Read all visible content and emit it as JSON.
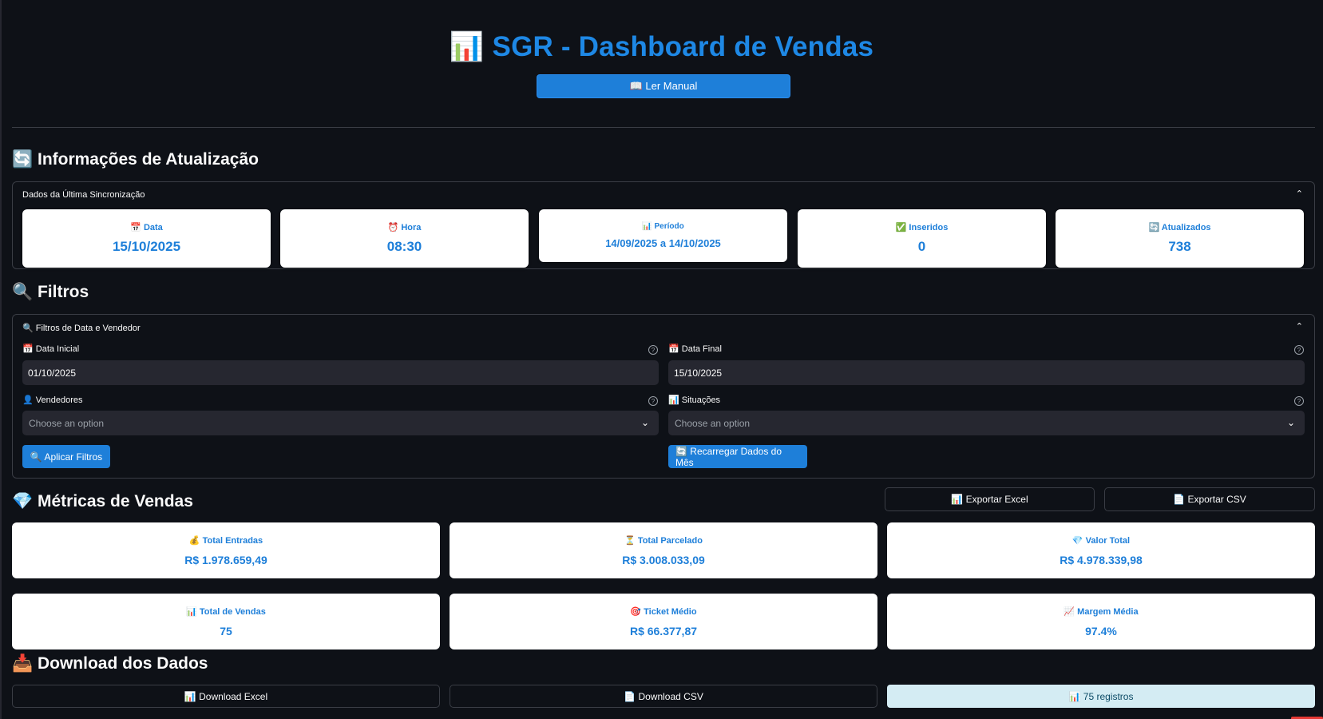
{
  "header": {
    "title": "📊 SGR - Dashboard de Vendas",
    "manual_button": "📖 Ler Manual"
  },
  "update_info": {
    "section_title": "🔄 Informações de Atualização",
    "expander_label": "Dados da Última Sincronização",
    "cards": [
      {
        "label": "📅 Data",
        "value": "15/10/2025"
      },
      {
        "label": "⏰ Hora",
        "value": "08:30"
      },
      {
        "label": "📊 Período",
        "value": "14/09/2025 a 14/10/2025"
      },
      {
        "label": "✅ Inseridos",
        "value": "0"
      },
      {
        "label": "🔄 Atualizados",
        "value": "738"
      }
    ]
  },
  "filters": {
    "section_title": "🔍 Filtros",
    "expander_label": "🔍 Filtros de Data e Vendedor",
    "start_date_label": "📅 Data Inicial",
    "start_date_value": "01/10/2025",
    "end_date_label": "📅 Data Final",
    "end_date_value": "15/10/2025",
    "sellers_label": "👤 Vendedores",
    "sellers_placeholder": "Choose an option",
    "status_label": "📊 Situações",
    "status_placeholder": "Choose an option",
    "apply_button": "🔍 Aplicar Filtros",
    "reload_button": "🔄 Recarregar Dados do Mês"
  },
  "metrics": {
    "section_title": "💎 Métricas de Vendas",
    "export_excel": "📊 Exportar Excel",
    "export_csv": "📄 Exportar CSV",
    "cards": [
      {
        "label": "💰 Total Entradas",
        "value": "R$ 1.978.659,49"
      },
      {
        "label": "⏳ Total Parcelado",
        "value": "R$ 3.008.033,09"
      },
      {
        "label": "💎 Valor Total",
        "value": "R$ 4.978.339,98"
      },
      {
        "label": "📊 Total de Vendas",
        "value": "75"
      },
      {
        "label": "🎯 Ticket Médio",
        "value": "R$ 66.377,87"
      },
      {
        "label": "📈 Margem Média",
        "value": "97.4%"
      }
    ]
  },
  "download": {
    "section_title": "📥 Download dos Dados",
    "excel_button": "📊 Download Excel",
    "csv_button": "📄 Download CSV",
    "records": "📊 75 registros"
  },
  "colors": {
    "background": "#0e1117",
    "accent": "#1e88e5",
    "card": "#ffffff",
    "input": "#262730"
  }
}
